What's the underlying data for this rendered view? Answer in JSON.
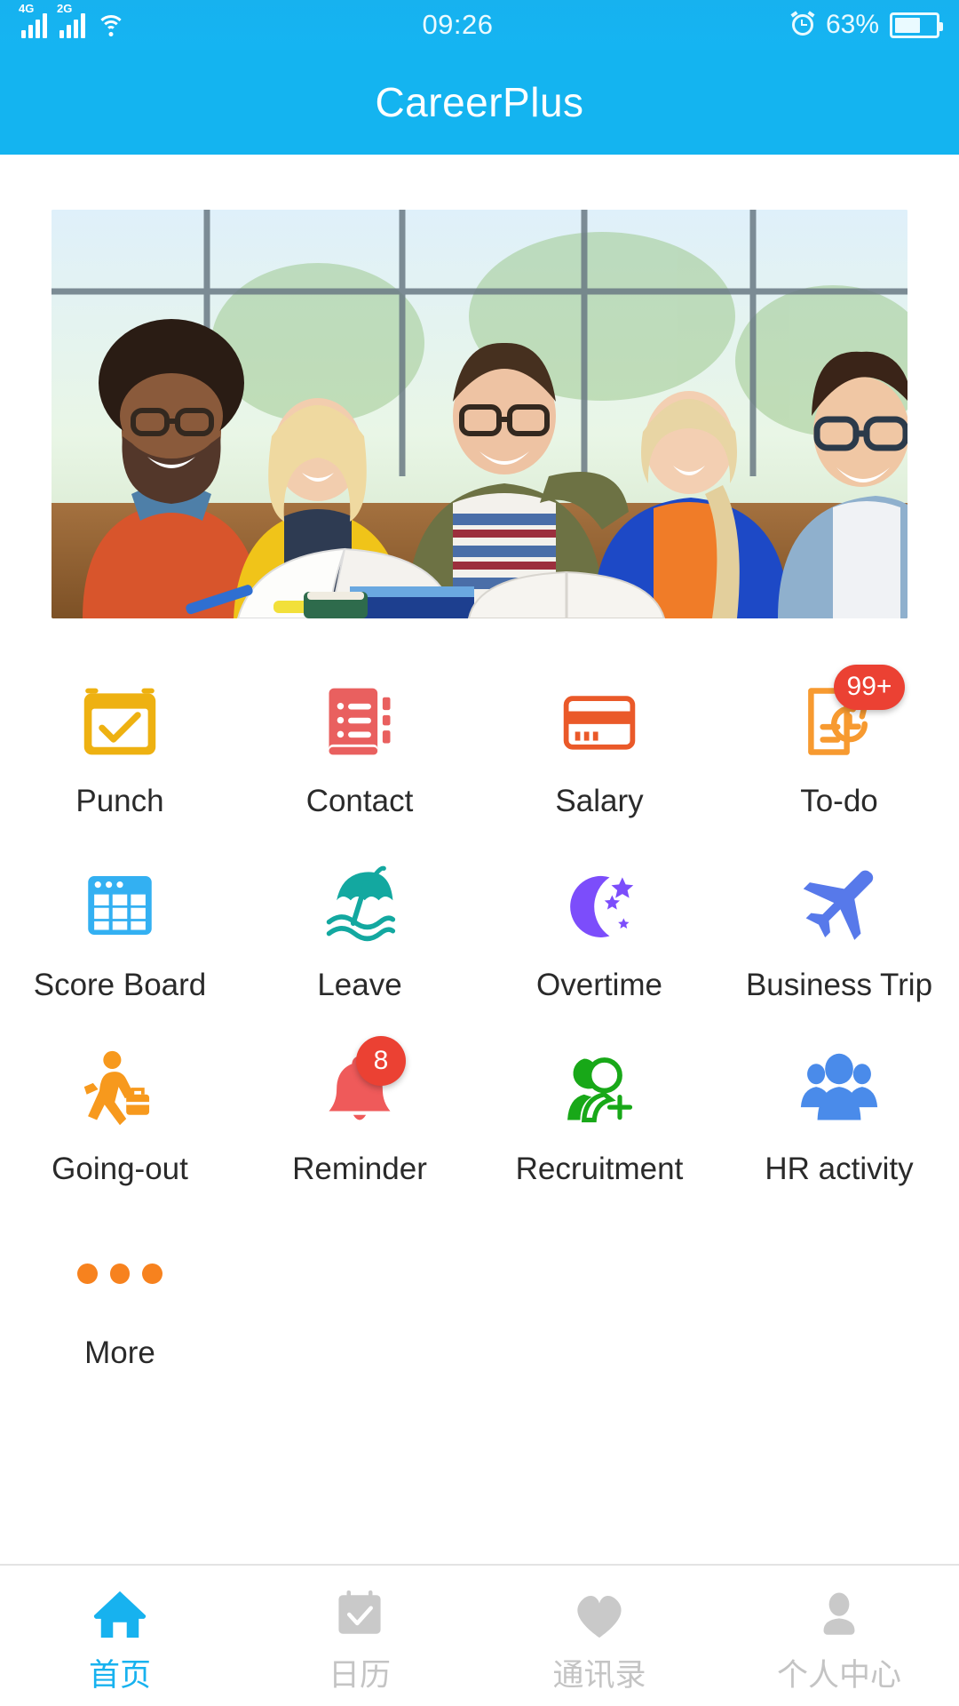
{
  "status_bar": {
    "network_1": "4G",
    "network_2": "2G",
    "wifi_icon": "wifi-icon",
    "time": "09:26",
    "alarm_icon": "alarm-clock-icon",
    "battery_percent": "63%",
    "battery_level": 63
  },
  "header": {
    "title": "CareerPlus",
    "background_color": "#14b4f0"
  },
  "banner": {
    "alt": "five smiling colleagues around a table with books"
  },
  "grid": {
    "items": [
      {
        "label": "Punch",
        "icon": "calendar-check-icon",
        "color": "#eeb111",
        "badge": null
      },
      {
        "label": "Contact",
        "icon": "address-book-icon",
        "color": "#e9605f",
        "badge": null
      },
      {
        "label": "Salary",
        "icon": "credit-card-icon",
        "color": "#ea5929",
        "badge": null
      },
      {
        "label": "To-do",
        "icon": "document-clock-icon",
        "color": "#f79a30",
        "badge": "99+"
      },
      {
        "label": "Score Board",
        "icon": "table-grid-icon",
        "color": "#33b0f2",
        "badge": null
      },
      {
        "label": "Leave",
        "icon": "beach-umbrella-icon",
        "color": "#13a8a0",
        "badge": null
      },
      {
        "label": "Overtime",
        "icon": "moon-stars-icon",
        "color": "#7c4dfb",
        "badge": null
      },
      {
        "label": "Business Trip",
        "icon": "airplane-icon",
        "color": "#5779ea",
        "badge": null
      },
      {
        "label": "Going-out",
        "icon": "traveler-walking-icon",
        "color": "#f7991d",
        "badge": null
      },
      {
        "label": "Reminder",
        "icon": "bell-icon",
        "color": "#ef5a5a",
        "badge": "8"
      },
      {
        "label": "Recruitment",
        "icon": "person-add-icon",
        "color": "#18a818",
        "badge": null
      },
      {
        "label": "HR activity",
        "icon": "people-group-icon",
        "color": "#4a8bea",
        "badge": null
      },
      {
        "label": "More",
        "icon": "three-dots-icon",
        "color": "#f7821e",
        "badge": null
      }
    ],
    "badge_color": "#eb4133"
  },
  "tabbar": {
    "active_color": "#17b2ef",
    "inactive_color": "#c4c4c4",
    "items": [
      {
        "label": "首页",
        "icon": "home-icon",
        "active": true
      },
      {
        "label": "日历",
        "icon": "calendar-check-icon",
        "active": false
      },
      {
        "label": "通讯录",
        "icon": "heart-icon",
        "active": false
      },
      {
        "label": "个人中心",
        "icon": "person-icon",
        "active": false
      }
    ]
  }
}
